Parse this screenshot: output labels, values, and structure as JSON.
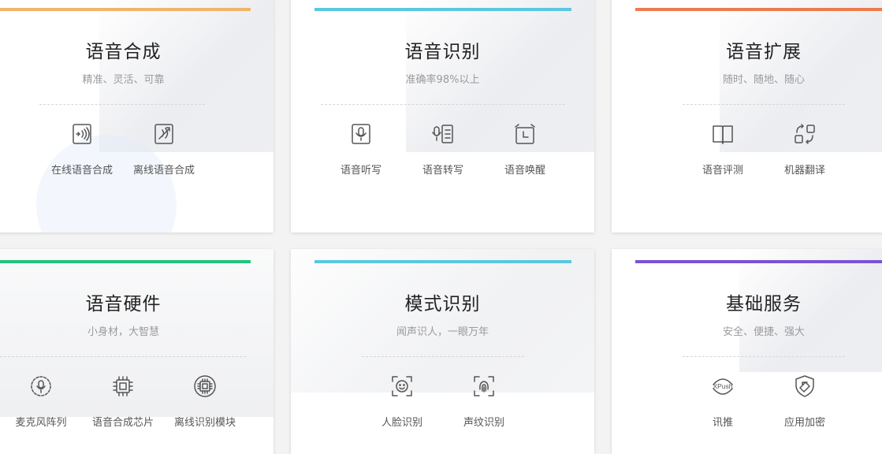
{
  "cards": [
    {
      "title": "语音合成",
      "subtitle": "精准、灵活、可靠",
      "accent": "#f0b46a",
      "features": [
        {
          "label": "在线语音合成",
          "icon": "online-speech-synthesis-icon"
        },
        {
          "label": "离线语音合成",
          "icon": "offline-speech-synthesis-icon"
        }
      ]
    },
    {
      "title": "语音识别",
      "subtitle": "准确率98%以上",
      "accent": "#5ac8e0",
      "features": [
        {
          "label": "语音听写",
          "icon": "voice-dictation-icon"
        },
        {
          "label": "语音转写",
          "icon": "voice-transcription-icon"
        },
        {
          "label": "语音唤醒",
          "icon": "voice-wakeup-icon"
        }
      ]
    },
    {
      "title": "语音扩展",
      "subtitle": "随时、随地、随心",
      "accent": "#ee7a4d",
      "features": [
        {
          "label": "语音评测",
          "icon": "voice-evaluation-icon"
        },
        {
          "label": "机器翻译",
          "icon": "machine-translation-icon"
        }
      ]
    },
    {
      "title": "语音硬件",
      "subtitle": "小身材，大智慧",
      "accent": "#22c47e",
      "features": [
        {
          "label": "麦克风阵列",
          "icon": "microphone-array-icon"
        },
        {
          "label": "语音合成芯片",
          "icon": "speech-synthesis-chip-icon"
        },
        {
          "label": "离线识别模块",
          "icon": "offline-recognition-module-icon"
        }
      ]
    },
    {
      "title": "模式识别",
      "subtitle": "闻声识人，一眼万年",
      "accent": "#5ac8e0",
      "features": [
        {
          "label": "人脸识别",
          "icon": "face-recognition-icon"
        },
        {
          "label": "声纹识别",
          "icon": "voiceprint-recognition-icon"
        }
      ]
    },
    {
      "title": "基础服务",
      "subtitle": "安全、便捷、强大",
      "accent": "#7b52d6",
      "features": [
        {
          "label": "讯推",
          "icon": "xpush-icon",
          "icon_text": "XPush"
        },
        {
          "label": "应用加密",
          "icon": "app-encryption-icon"
        }
      ]
    }
  ]
}
